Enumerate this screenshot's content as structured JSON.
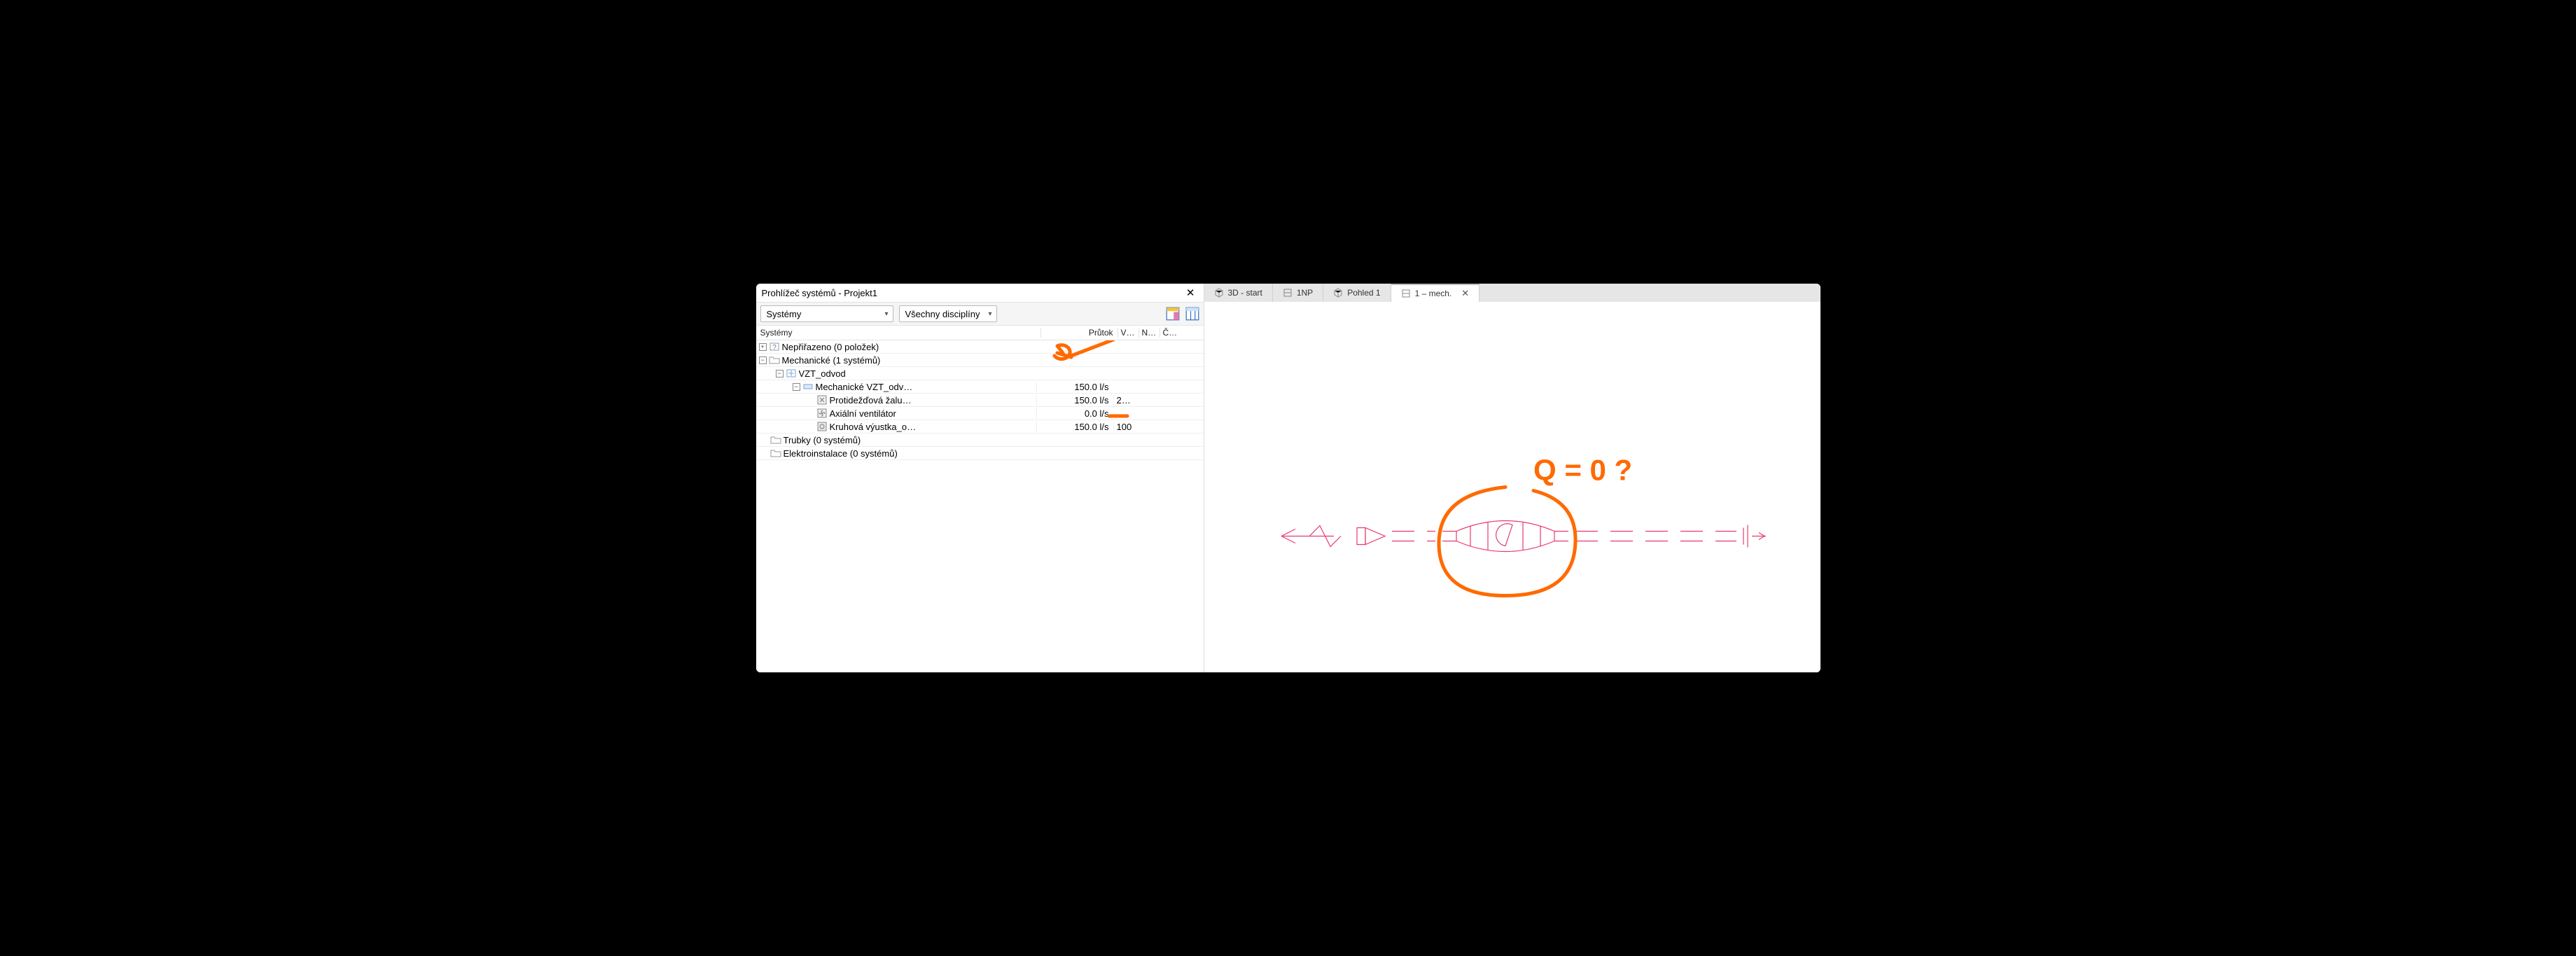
{
  "panel": {
    "title": "Prohlížeč systémů - Projekt1",
    "dropdown1": "Systémy",
    "dropdown2": "Všechny disciplíny",
    "group_label": "Systémy",
    "cols": {
      "flow": "Průtok",
      "v": "V…",
      "n": "N…",
      "c": "Č…"
    }
  },
  "tree": {
    "r0": {
      "label": "Nepřiřazeno (0 položek)"
    },
    "r1": {
      "label": "Mechanické (1 systémů)"
    },
    "r2": {
      "label": "VZT_odvod"
    },
    "r3": {
      "label": "Mechanické VZT_odv…",
      "flow": "150.0 l/s"
    },
    "r4": {
      "label": "Protidežďová žalu…",
      "flow": "150.0 l/s",
      "v": "2…"
    },
    "r5": {
      "label": "Axiální ventilátor",
      "flow": "0.0 l/s"
    },
    "r6": {
      "label": "Kruhová výustka_o…",
      "flow": "150.0 l/s",
      "v": "100"
    },
    "r7": {
      "label": "Trubky (0 systémů)"
    },
    "r8": {
      "label": "Elektroinstalace (0 systémů)"
    }
  },
  "tabs": {
    "t0": "3D - start",
    "t1": "1NP",
    "t2": "Pohled 1",
    "t3": "1 – mech."
  },
  "annot": {
    "q": "Q = 0 ?"
  }
}
